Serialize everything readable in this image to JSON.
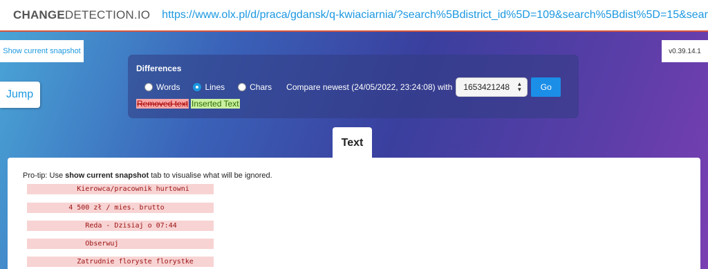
{
  "header": {
    "brand_bold": "CHANGE",
    "brand_rest": "DETECTION.IO",
    "url": "https://www.olx.pl/d/praca/gdansk/q-kwiaciarnia/?search%5Bdistrict_id%5D=109&search%5Bdist%5D=15&search"
  },
  "side": {
    "snapshot_label": "Show current snapshot",
    "jump_label": "Jump",
    "version": "v0.39.14.1"
  },
  "diff": {
    "title": "Differences",
    "options": [
      {
        "label": "Words",
        "checked": false
      },
      {
        "label": "Lines",
        "checked": true
      },
      {
        "label": "Chars",
        "checked": false
      }
    ],
    "compare_text": "Compare newest (24/05/2022, 23:24:08) with",
    "selected_version": "1653421248",
    "go_label": "Go",
    "legend_removed": "Removed text",
    "legend_inserted": "Inserted Text"
  },
  "tabs": {
    "text_label": "Text"
  },
  "content": {
    "protip_prefix": "Pro-tip: Use ",
    "protip_bold": "show current snapshot",
    "protip_suffix": " tab to visualise what will be ignored.",
    "lines": [
      "            Kierowca/pracownik hurtowni",
      "          4 500 zł / mies. brutto",
      "              Reda - Dzisiaj o 07:44",
      "              Obserwuj",
      "            Zatrudnie floryste florystke"
    ]
  },
  "colors": {
    "accent": "#1b98e0",
    "removed_bg": "#f7a6a6",
    "inserted_bg": "#cbf0a1",
    "header_border": "#d6543a"
  }
}
